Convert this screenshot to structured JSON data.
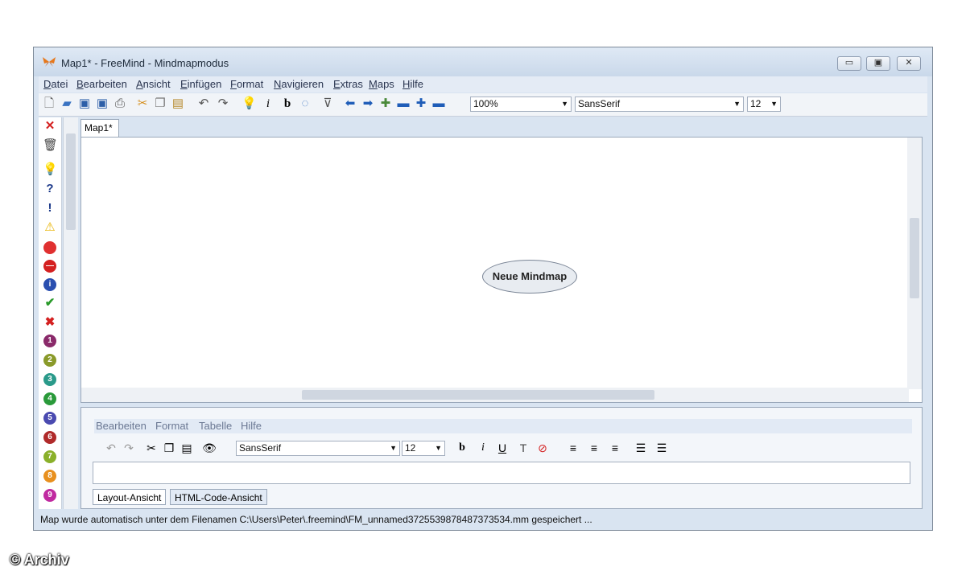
{
  "window": {
    "title": "Map1* - FreeMind - Mindmapmodus"
  },
  "menu": [
    "Datei",
    "Bearbeiten",
    "Ansicht",
    "Einfügen",
    "Format",
    "Navigieren",
    "Extras",
    "Maps",
    "Hilfe"
  ],
  "toolbar": {
    "zoom": "100%",
    "font": "SansSerif",
    "size": "12"
  },
  "tab": {
    "label": "Map1*"
  },
  "map": {
    "root_node": "Neue Mindmap"
  },
  "editor": {
    "menu": [
      "Bearbeiten",
      "Format",
      "Tabelle",
      "Hilfe"
    ],
    "font": "SansSerif",
    "size": "12",
    "tabs": [
      "Layout-Ansicht",
      "HTML-Code-Ansicht"
    ]
  },
  "status": "Map wurde automatisch unter dem Filenamen C:\\Users\\Peter\\.freemind\\FM_unnamed3725539878487373534.mm gespeichert ...",
  "credit": "© Archiv",
  "colors": {
    "titlebar": "#c9d8ea",
    "node_fill": "#e8ecf1"
  }
}
